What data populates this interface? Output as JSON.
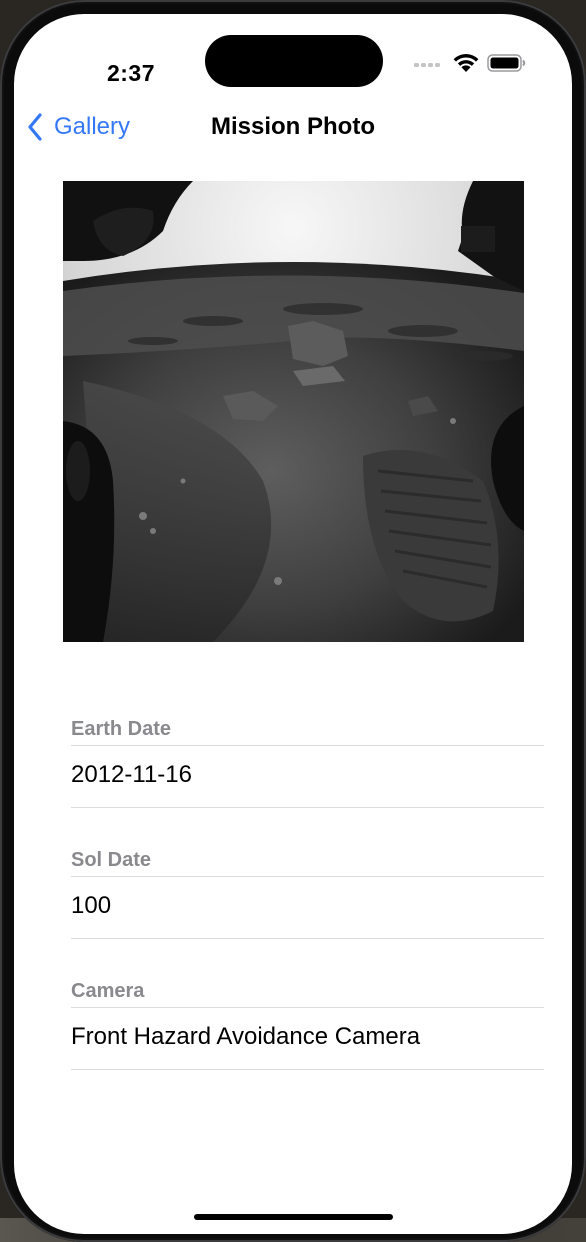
{
  "status_bar": {
    "time": "2:37"
  },
  "nav": {
    "back_label": "Gallery",
    "title": "Mission Photo"
  },
  "details": [
    {
      "label": "Earth Date",
      "value": "2012-11-16"
    },
    {
      "label": "Sol Date",
      "value": "100"
    },
    {
      "label": "Camera",
      "value": "Front Hazard Avoidance Camera"
    }
  ],
  "colors": {
    "accent": "#3478f6",
    "section_header": "#8a8a8e",
    "separator": "#dcdcde"
  }
}
